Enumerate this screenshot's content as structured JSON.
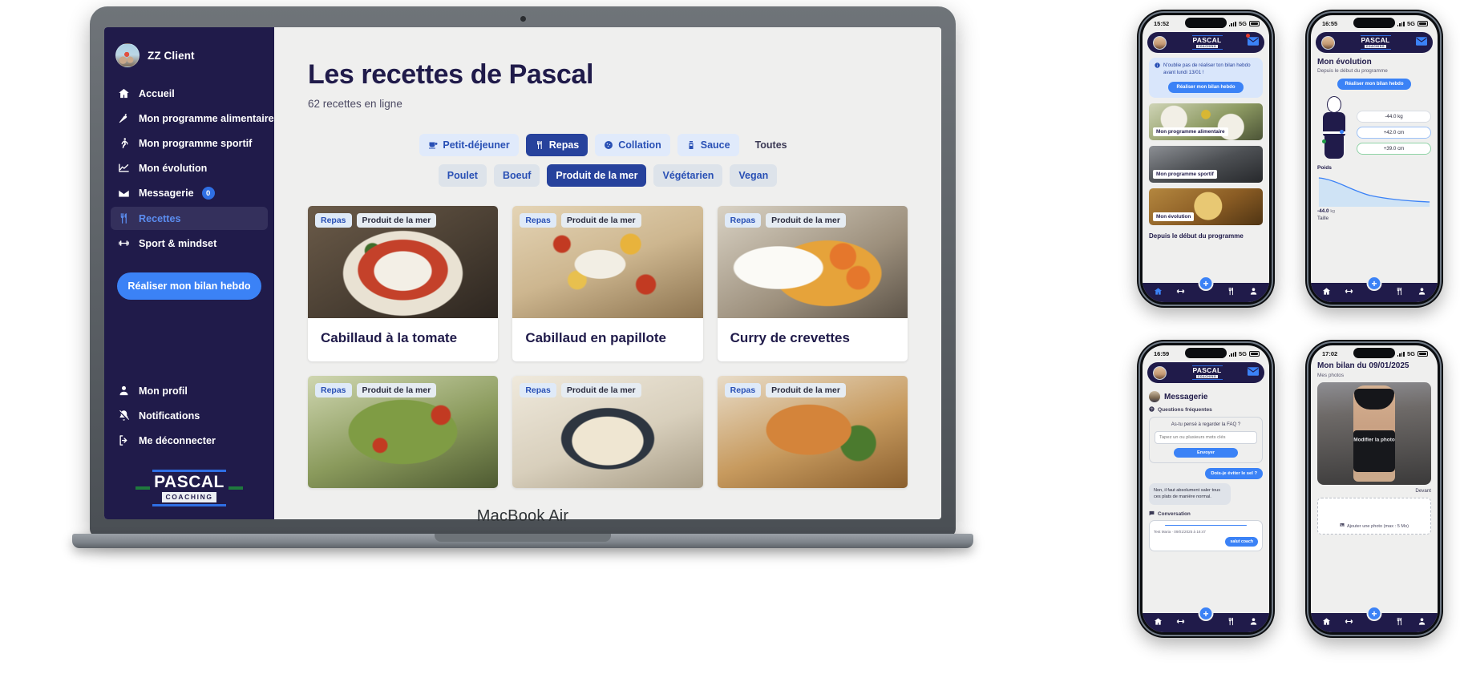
{
  "laptop": {
    "label": "MacBook Air"
  },
  "sidebar": {
    "user": {
      "name": "ZZ Client",
      "avatar_icon": "user-avatar"
    },
    "items": [
      {
        "label": "Accueil",
        "icon": "home-icon",
        "active": false
      },
      {
        "label": "Mon programme alimentaire",
        "icon": "carrot-icon",
        "active": false
      },
      {
        "label": "Mon programme sportif",
        "icon": "runner-icon",
        "active": false
      },
      {
        "label": "Mon évolution",
        "icon": "chart-line-icon",
        "active": false
      },
      {
        "label": "Messagerie",
        "icon": "envelope-icon",
        "badge": "0",
        "active": false
      },
      {
        "label": "Recettes",
        "icon": "cutlery-icon",
        "active": true
      },
      {
        "label": "Sport & mindset",
        "icon": "dumbbell-icon",
        "active": false
      }
    ],
    "cta": {
      "label": "Réaliser mon bilan hebdo"
    },
    "bottom_items": [
      {
        "label": "Mon profil",
        "icon": "person-icon"
      },
      {
        "label": "Notifications",
        "icon": "bell-slash-icon"
      },
      {
        "label": "Me déconnecter",
        "icon": "logout-icon"
      }
    ],
    "logo": {
      "name": "PASCAL",
      "tagline": "COACHING"
    }
  },
  "main": {
    "title": "Les recettes de Pascal",
    "subtitle": "62 recettes en ligne",
    "filters_primary": [
      {
        "label": "Petit-déjeuner",
        "icon": "coffee-icon",
        "active": false,
        "style": "soft"
      },
      {
        "label": "Repas",
        "icon": "cutlery-icon",
        "active": true,
        "style": "soft"
      },
      {
        "label": "Collation",
        "icon": "cookie-icon",
        "active": false,
        "style": "soft"
      },
      {
        "label": "Sauce",
        "icon": "jar-icon",
        "active": false,
        "style": "soft"
      },
      {
        "label": "Toutes",
        "icon": "",
        "active": false,
        "style": "ghost"
      }
    ],
    "filters_secondary": [
      {
        "label": "Poulet",
        "active": false
      },
      {
        "label": "Boeuf",
        "active": false
      },
      {
        "label": "Produit de la mer",
        "active": true
      },
      {
        "label": "Végétarien",
        "active": false
      },
      {
        "label": "Vegan",
        "active": false
      }
    ],
    "recipes": [
      {
        "title": "Cabillaud à la tomate",
        "tag1": "Repas",
        "tag2": "Produit de la mer",
        "photo": "ph1"
      },
      {
        "title": "Cabillaud en papillote",
        "tag1": "Repas",
        "tag2": "Produit de la mer",
        "photo": "ph2"
      },
      {
        "title": "Curry de crevettes",
        "tag1": "Repas",
        "tag2": "Produit de la mer",
        "photo": "ph3"
      },
      {
        "title": "",
        "tag1": "Repas",
        "tag2": "Produit de la mer",
        "photo": "ph4"
      },
      {
        "title": "",
        "tag1": "Repas",
        "tag2": "Produit de la mer",
        "photo": "ph5"
      },
      {
        "title": "",
        "tag1": "Repas",
        "tag2": "Produit de la mer",
        "photo": "ph6"
      }
    ]
  },
  "phone_home": {
    "status_time": "15:52",
    "status_network": "5G",
    "alert_text": "N'oublie pas de réaliser ton bilan hebdo avant lundi 13/01 !",
    "alert_button": "Réaliser mon bilan hebdo",
    "tiles": [
      {
        "label": "Mon programme alimentaire",
        "photo": "tile-food"
      },
      {
        "label": "Mon programme sportif",
        "photo": "tile-sport"
      },
      {
        "label": "Mon évolution",
        "photo": "tile-evo"
      }
    ],
    "section_title": "Depuis le début du programme",
    "fab": "+"
  },
  "phone_evolution": {
    "status_time": "16:55",
    "status_network": "5G",
    "title": "Mon évolution",
    "subtitle": "Depuis le début du programme",
    "button": "Réaliser mon bilan hebdo",
    "chips": [
      {
        "value": "-44.0 kg",
        "tone": "plain"
      },
      {
        "value": "+42.0 cm",
        "tone": "blue"
      },
      {
        "value": "+39.0 cm",
        "tone": "green"
      }
    ],
    "weight_label": "Poids",
    "weight_value": "-44.0",
    "weight_unit": "kg",
    "size_label": "Taille",
    "fab": "+"
  },
  "phone_messages": {
    "status_time": "16:59",
    "status_network": "5G",
    "title": "Messagerie",
    "faq_label": "Questions fréquentes",
    "question": "As-tu pensé à regarder la FAQ ?",
    "faq_link": "FAQ",
    "input_placeholder": "Tapez un ou plusieurs mots clés",
    "send_label": "Envoyer",
    "bubble_out": "Dois-je éviter le sel ?",
    "bubble_in": "Non, il faut absolument saler tous ces plats de manière normal.",
    "conversation_label": "Conversation",
    "conv_meta": "Test Maria · 09/01/2025 à 16:47",
    "conv_bubble": "salut coach",
    "fab": "+"
  },
  "phone_report": {
    "status_time": "17:02",
    "status_network": "5G",
    "title": "Mon bilan du 09/01/2025",
    "subtitle": "Mes photos",
    "photo_action": "Modifier la photo",
    "photo_caption": "Devant",
    "add_photo": "Ajouter une photo (max : 5 Mo)",
    "fab": "+"
  },
  "colors": {
    "sidebar_bg": "#201b4a",
    "accent_blue": "#3b82f6",
    "active_pill": "#27429c",
    "page_bg": "#efefee",
    "green": "#1f9c46"
  }
}
